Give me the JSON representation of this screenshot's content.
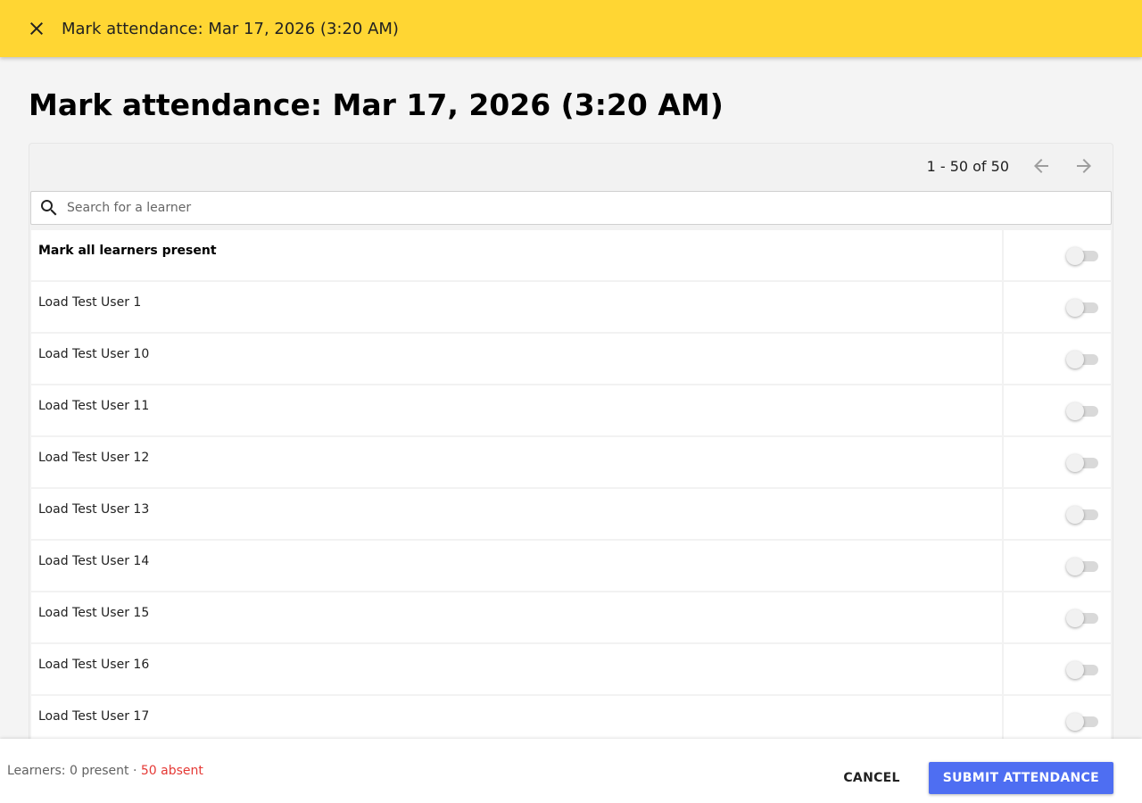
{
  "appbar": {
    "title": "Mark attendance: Mar 17, 2026 (3:20 AM)",
    "close_icon": "close-icon"
  },
  "page": {
    "title": "Mark attendance: Mar 17, 2026 (3:20 AM)"
  },
  "pager": {
    "range_text": "1 - 50 of 50",
    "prev_icon": "arrow-left-icon",
    "next_icon": "arrow-right-icon"
  },
  "search": {
    "placeholder": "Search for a learner",
    "value": "",
    "icon": "search-icon"
  },
  "mark_all": {
    "label": "Mark all learners present",
    "present": false
  },
  "learners": [
    {
      "name": "Load Test User 1",
      "present": false
    },
    {
      "name": "Load Test User 10",
      "present": false
    },
    {
      "name": "Load Test User 11",
      "present": false
    },
    {
      "name": "Load Test User 12",
      "present": false
    },
    {
      "name": "Load Test User 13",
      "present": false
    },
    {
      "name": "Load Test User 14",
      "present": false
    },
    {
      "name": "Load Test User 15",
      "present": false
    },
    {
      "name": "Load Test User 16",
      "present": false
    },
    {
      "name": "Load Test User 17",
      "present": false
    }
  ],
  "footer": {
    "status_prefix": "Learners: 0 present · ",
    "absent_text": "50 absent",
    "cancel_label": "CANCEL",
    "submit_label": "SUBMIT ATTENDANCE"
  },
  "colors": {
    "appbar": "#ffd633",
    "primary": "#4e6ef2",
    "absent": "#e53935"
  }
}
